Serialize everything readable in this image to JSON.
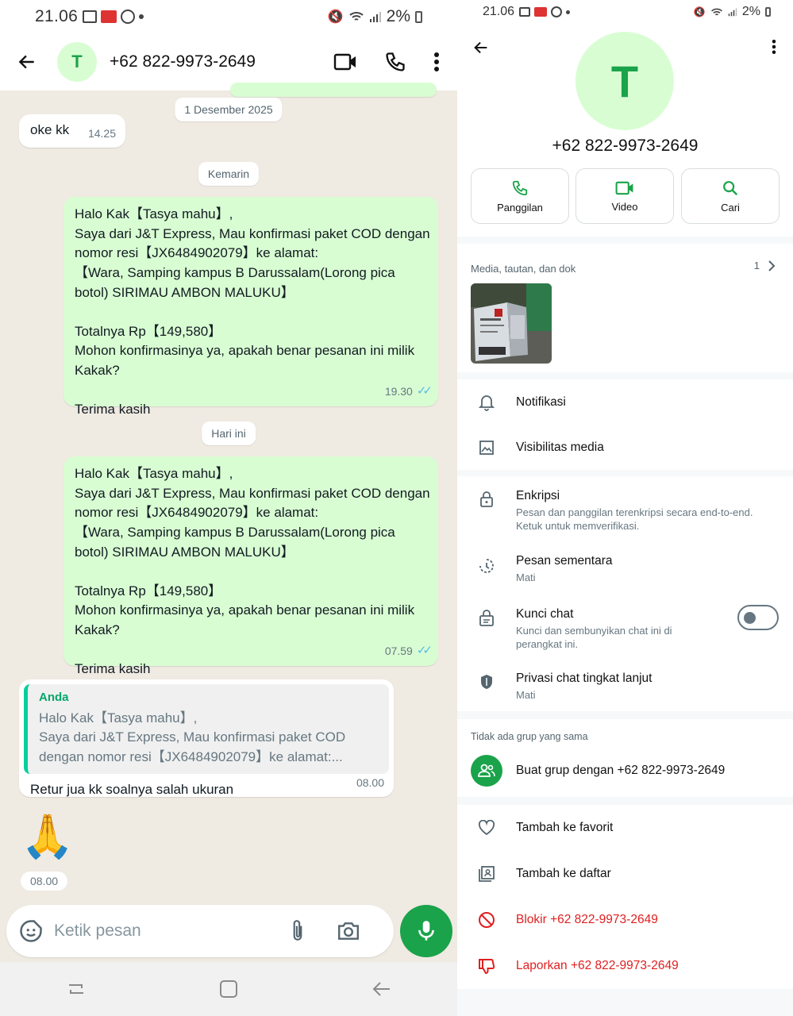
{
  "left": {
    "status_time": "21.06",
    "status_battery": "2%",
    "header": {
      "title": "+62 822-9973-2649",
      "avatar_letter": "T"
    },
    "date_pills": [
      "1 Desember 2025",
      "Kemarin",
      "Hari ini"
    ],
    "messages": [
      {
        "text": "oke kk",
        "time": "14.25"
      },
      {
        "text": "Halo Kak【Tasya mahu】,\nSaya dari J&T Express, Mau konfirmasi paket COD dengan nomor resi【JX6484902079】ke alamat:\n【Wara, Samping kampus B Darussalam(Lorong pica botol) SIRIMAU AMBON MALUKU】\n\nTotalnya Rp【149,580】\nMohon konfirmasinya ya, apakah benar pesanan ini milik Kakak?\n\nTerima kasih",
        "time": "19.30"
      },
      {
        "text": "Halo Kak【Tasya mahu】,\nSaya dari J&T Express, Mau konfirmasi paket COD dengan nomor resi【JX6484902079】ke alamat:\n【Wara, Samping kampus B Darussalam(Lorong pica botol) SIRIMAU AMBON MALUKU】\n\nTotalnya Rp【149,580】\nMohon konfirmasinya ya, apakah benar pesanan ini milik Kakak?\n\nTerima kasih",
        "time": "07.59"
      },
      {
        "quote_author": "Anda",
        "quote_text": "Halo Kak【Tasya mahu】,\nSaya dari J&T Express, Mau konfirmasi paket COD\ndengan nomor resi【JX6484902079】ke alamat:...",
        "text": "Retur jua kk soalnya salah ukuran",
        "time": "08.00"
      },
      {
        "emoji": "🙏",
        "time": "08.00"
      }
    ],
    "input_placeholder": "Ketik pesan"
  },
  "right": {
    "status_time": "21.06",
    "status_battery": "2%",
    "avatar_letter": "T",
    "contact_name": "+62 822-9973-2649",
    "actions": [
      "Panggilan",
      "Video",
      "Cari"
    ],
    "media_title": "Media, tautan, dan dok",
    "media_count": "1",
    "settings": {
      "notifikasi": "Notifikasi",
      "visibilitas": "Visibilitas media",
      "enkripsi": {
        "title": "Enkripsi",
        "sub": "Pesan dan panggilan terenkripsi secara end-to-end. Ketuk untuk memverifikasi."
      },
      "pesan_sementara": {
        "title": "Pesan sementara",
        "sub": "Mati"
      },
      "kunci_chat": {
        "title": "Kunci chat",
        "sub": "Kunci dan sembunyikan chat ini di perangkat ini.",
        "enabled": false
      },
      "privasi": {
        "title": "Privasi chat tingkat lanjut",
        "sub": "Mati"
      }
    },
    "groups_title": "Tidak ada grup yang sama",
    "create_group": "Buat grup dengan +62 822-9973-2649",
    "bottom_actions": [
      "Tambah ke favorit",
      "Tambah ke daftar",
      "Blokir +62 822-9973-2649",
      "Laporkan +62 822-9973-2649"
    ]
  },
  "colors": {
    "accent": "#1aa34a",
    "chat_bg": "#efeae2",
    "bubble_out": "#d9fdd3",
    "danger": "#e02020",
    "tick": "#53bdeb"
  }
}
